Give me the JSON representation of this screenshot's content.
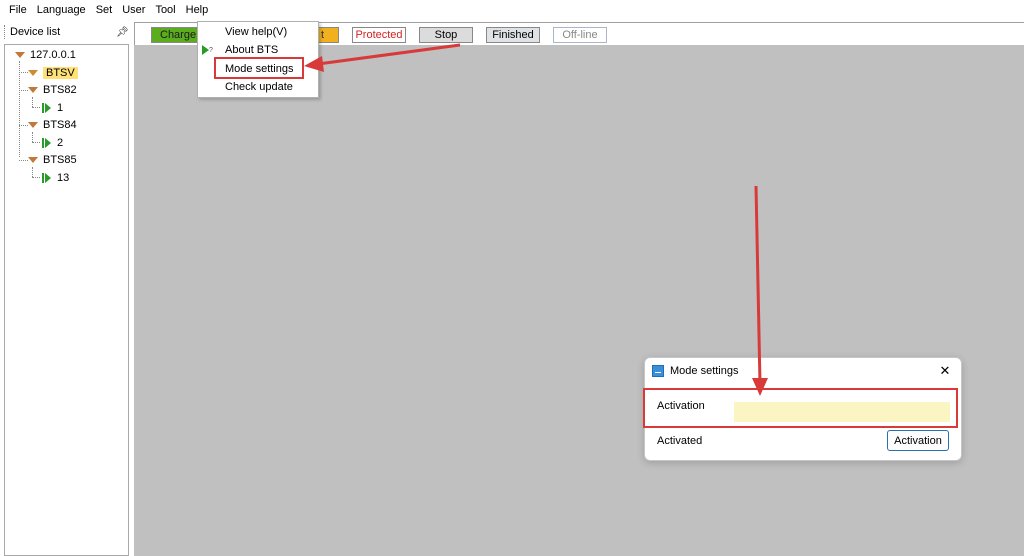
{
  "menubar": {
    "items": [
      "File",
      "Language",
      "Set",
      "User",
      "Tool",
      "Help"
    ]
  },
  "device_panel": {
    "title": "Device list",
    "pin_icon": "pin-icon",
    "tree": {
      "root": "127.0.0.1",
      "nodes": [
        {
          "label": "BTSV",
          "selected": true
        },
        {
          "label": "BTS82",
          "child": "1"
        },
        {
          "label": "BTS84",
          "child": "2"
        },
        {
          "label": "BTS85",
          "child": "13"
        }
      ]
    }
  },
  "status_bar": {
    "charge": "Charge",
    "wait": "t",
    "protected": "Protected",
    "stop": "Stop",
    "finished": "Finished",
    "offline": "Off-line"
  },
  "help_menu": {
    "items": [
      "View help(V)",
      "About BTS",
      "Mode settings",
      "Check update"
    ]
  },
  "dialog": {
    "title": "Mode settings",
    "activation_label": "Activation",
    "activation_value": "",
    "activated_label": "Activated",
    "activation_button": "Activation"
  },
  "colors": {
    "charge": "#5cad1e",
    "wait": "#f2b01f",
    "protected_text": "#d52222",
    "selection": "#ffe178",
    "annotation": "#d83a3a",
    "activation_field": "#fbf5c4",
    "main_background": "#c0c0c0"
  }
}
